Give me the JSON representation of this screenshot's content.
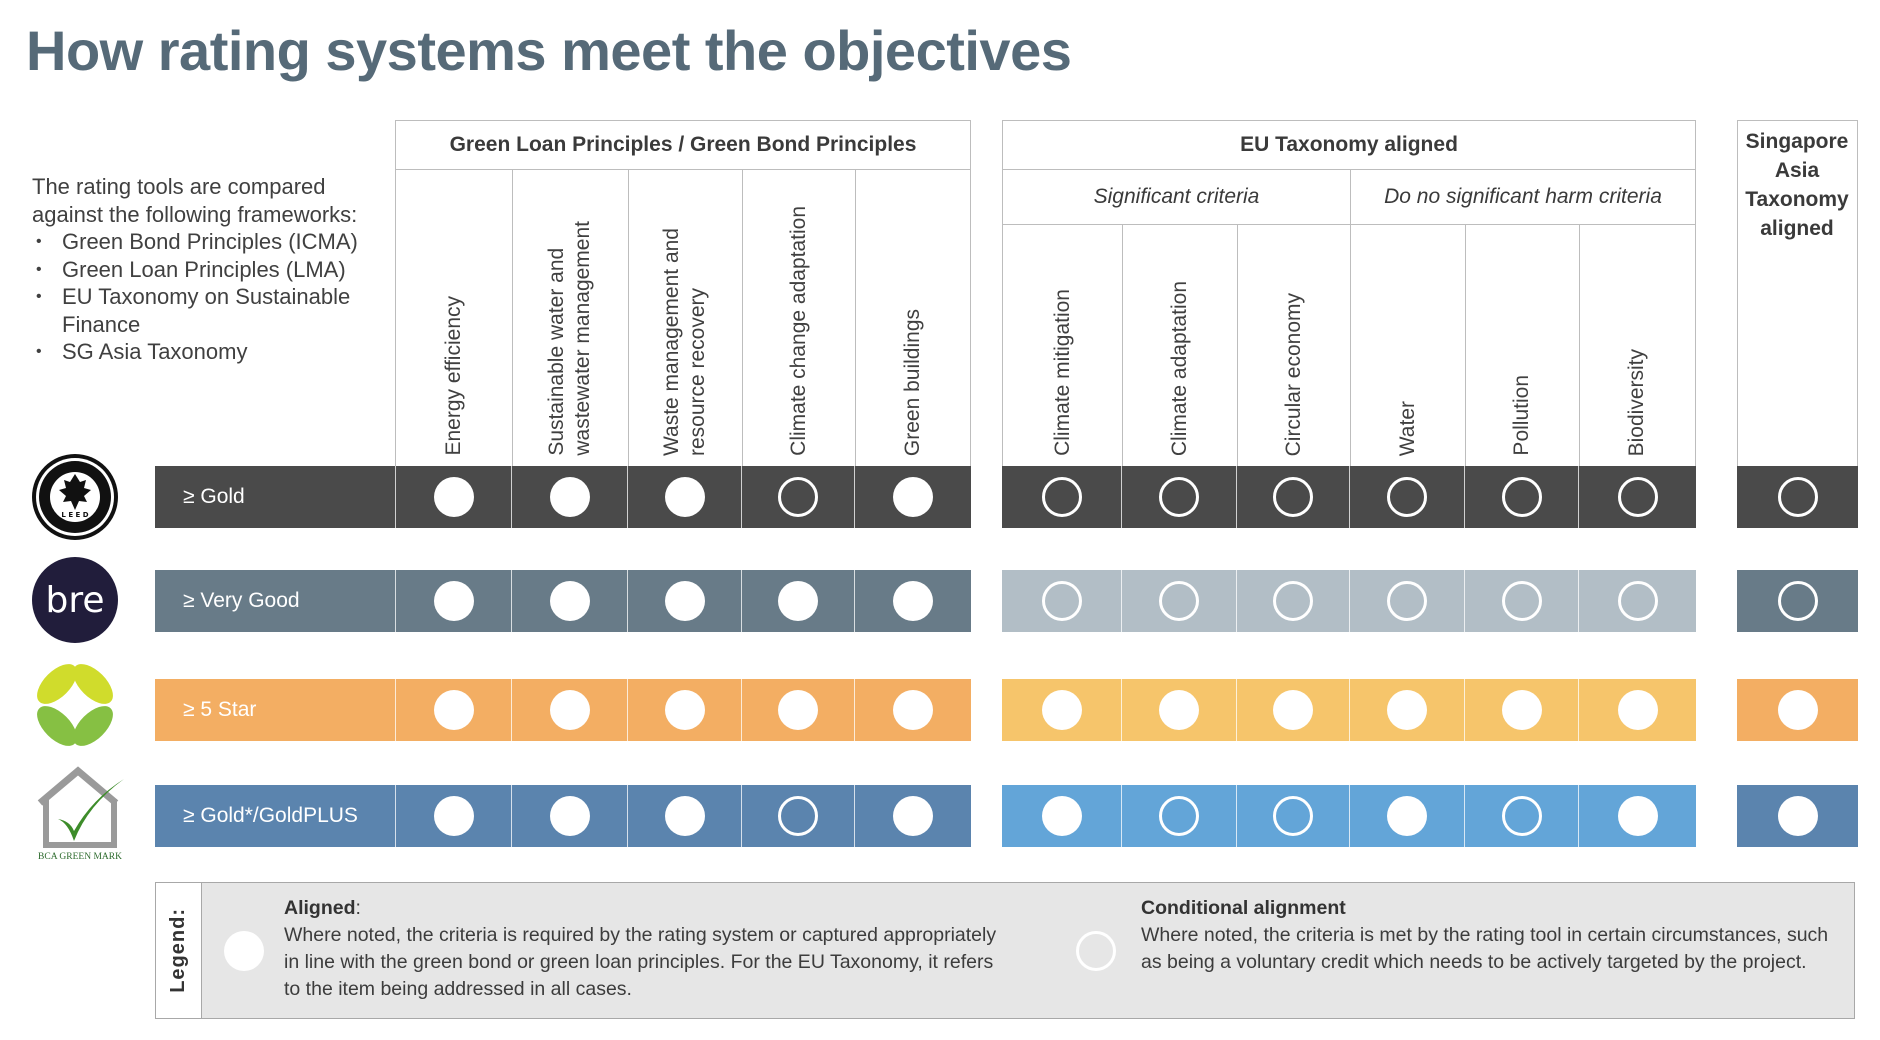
{
  "title": "How rating systems meet the objectives",
  "intro": {
    "text": "The rating tools are compared against the following frameworks:",
    "bullets": [
      "Green Bond Principles (ICMA)",
      "Green Loan Principles (LMA)",
      "EU Taxonomy on Sustainable Finance",
      "SG Asia Taxonomy"
    ]
  },
  "groups": {
    "glp": {
      "title": "Green Loan Principles / Green Bond Principles",
      "columns": [
        "Energy efficiency",
        "Sustainable water and\nwastewater management",
        "Waste management and\nresource recovery",
        "Climate change adaptation",
        "Green buildings"
      ]
    },
    "eu": {
      "title": "EU Taxonomy aligned",
      "sub_significant": "Significant criteria",
      "sub_dnsh": "Do no significant harm criteria",
      "columns": [
        "Climate mitigation",
        "Climate adaptation",
        "Circular economy",
        "Water",
        "Pollution",
        "Biodiversity"
      ]
    },
    "sg": {
      "title": "Singapore Asia Taxonomy aligned"
    }
  },
  "rows": [
    {
      "system": "LEED (USGBC)",
      "logo": "leed-usgbc-logo",
      "label": "≥ Gold",
      "colors": {
        "main": "#4a4a4a",
        "eu": "#4a4a4a",
        "sg": "#4a4a4a"
      },
      "glp": [
        "aligned",
        "aligned",
        "aligned",
        "conditional",
        "aligned"
      ],
      "eu": [
        "conditional",
        "conditional",
        "conditional",
        "conditional",
        "conditional",
        "conditional"
      ],
      "sg": "conditional"
    },
    {
      "system": "BREEAM (bre)",
      "logo": "bre-logo",
      "label": "≥ Very Good",
      "colors": {
        "main": "#687b88",
        "eu": "#b2bec6",
        "sg": "#687b88"
      },
      "glp": [
        "aligned",
        "aligned",
        "aligned",
        "aligned",
        "aligned"
      ],
      "eu": [
        "conditional",
        "conditional",
        "conditional",
        "conditional",
        "conditional",
        "conditional"
      ],
      "sg": "conditional"
    },
    {
      "system": "Green Star",
      "logo": "green-star-logo",
      "label": "≥ 5 Star",
      "colors": {
        "main": "#f3ae63",
        "eu": "#f6c56b",
        "sg": "#f3ae63"
      },
      "glp": [
        "aligned",
        "aligned",
        "aligned",
        "aligned",
        "aligned"
      ],
      "eu": [
        "aligned",
        "aligned",
        "aligned",
        "aligned",
        "aligned",
        "aligned"
      ],
      "sg": "aligned"
    },
    {
      "system": "BCA Green Mark",
      "logo": "bca-green-mark-logo",
      "logo_caption": "BCA GREEN MARK",
      "label": "≥ Gold*/GoldPLUS",
      "colors": {
        "main": "#5b84ae",
        "eu": "#63a5d8",
        "sg": "#5b84ae"
      },
      "glp": [
        "aligned",
        "aligned",
        "aligned",
        "conditional",
        "aligned"
      ],
      "eu": [
        "aligned",
        "conditional",
        "conditional",
        "aligned",
        "conditional",
        "aligned"
      ],
      "sg": "aligned"
    }
  ],
  "legend": {
    "heading": "Legend:",
    "aligned": {
      "title": "Aligned",
      "title_suffix": ":",
      "text": "Where noted, the criteria is required by the rating system or captured appropriately in line with the green bond or green loan principles. For the EU Taxonomy, it refers to the item being addressed in all cases."
    },
    "conditional": {
      "title": "Conditional alignment",
      "text": "Where noted, the criteria is met by the rating tool in certain circumstances, such as being a voluntary credit which needs to be actively targeted by the project."
    }
  }
}
